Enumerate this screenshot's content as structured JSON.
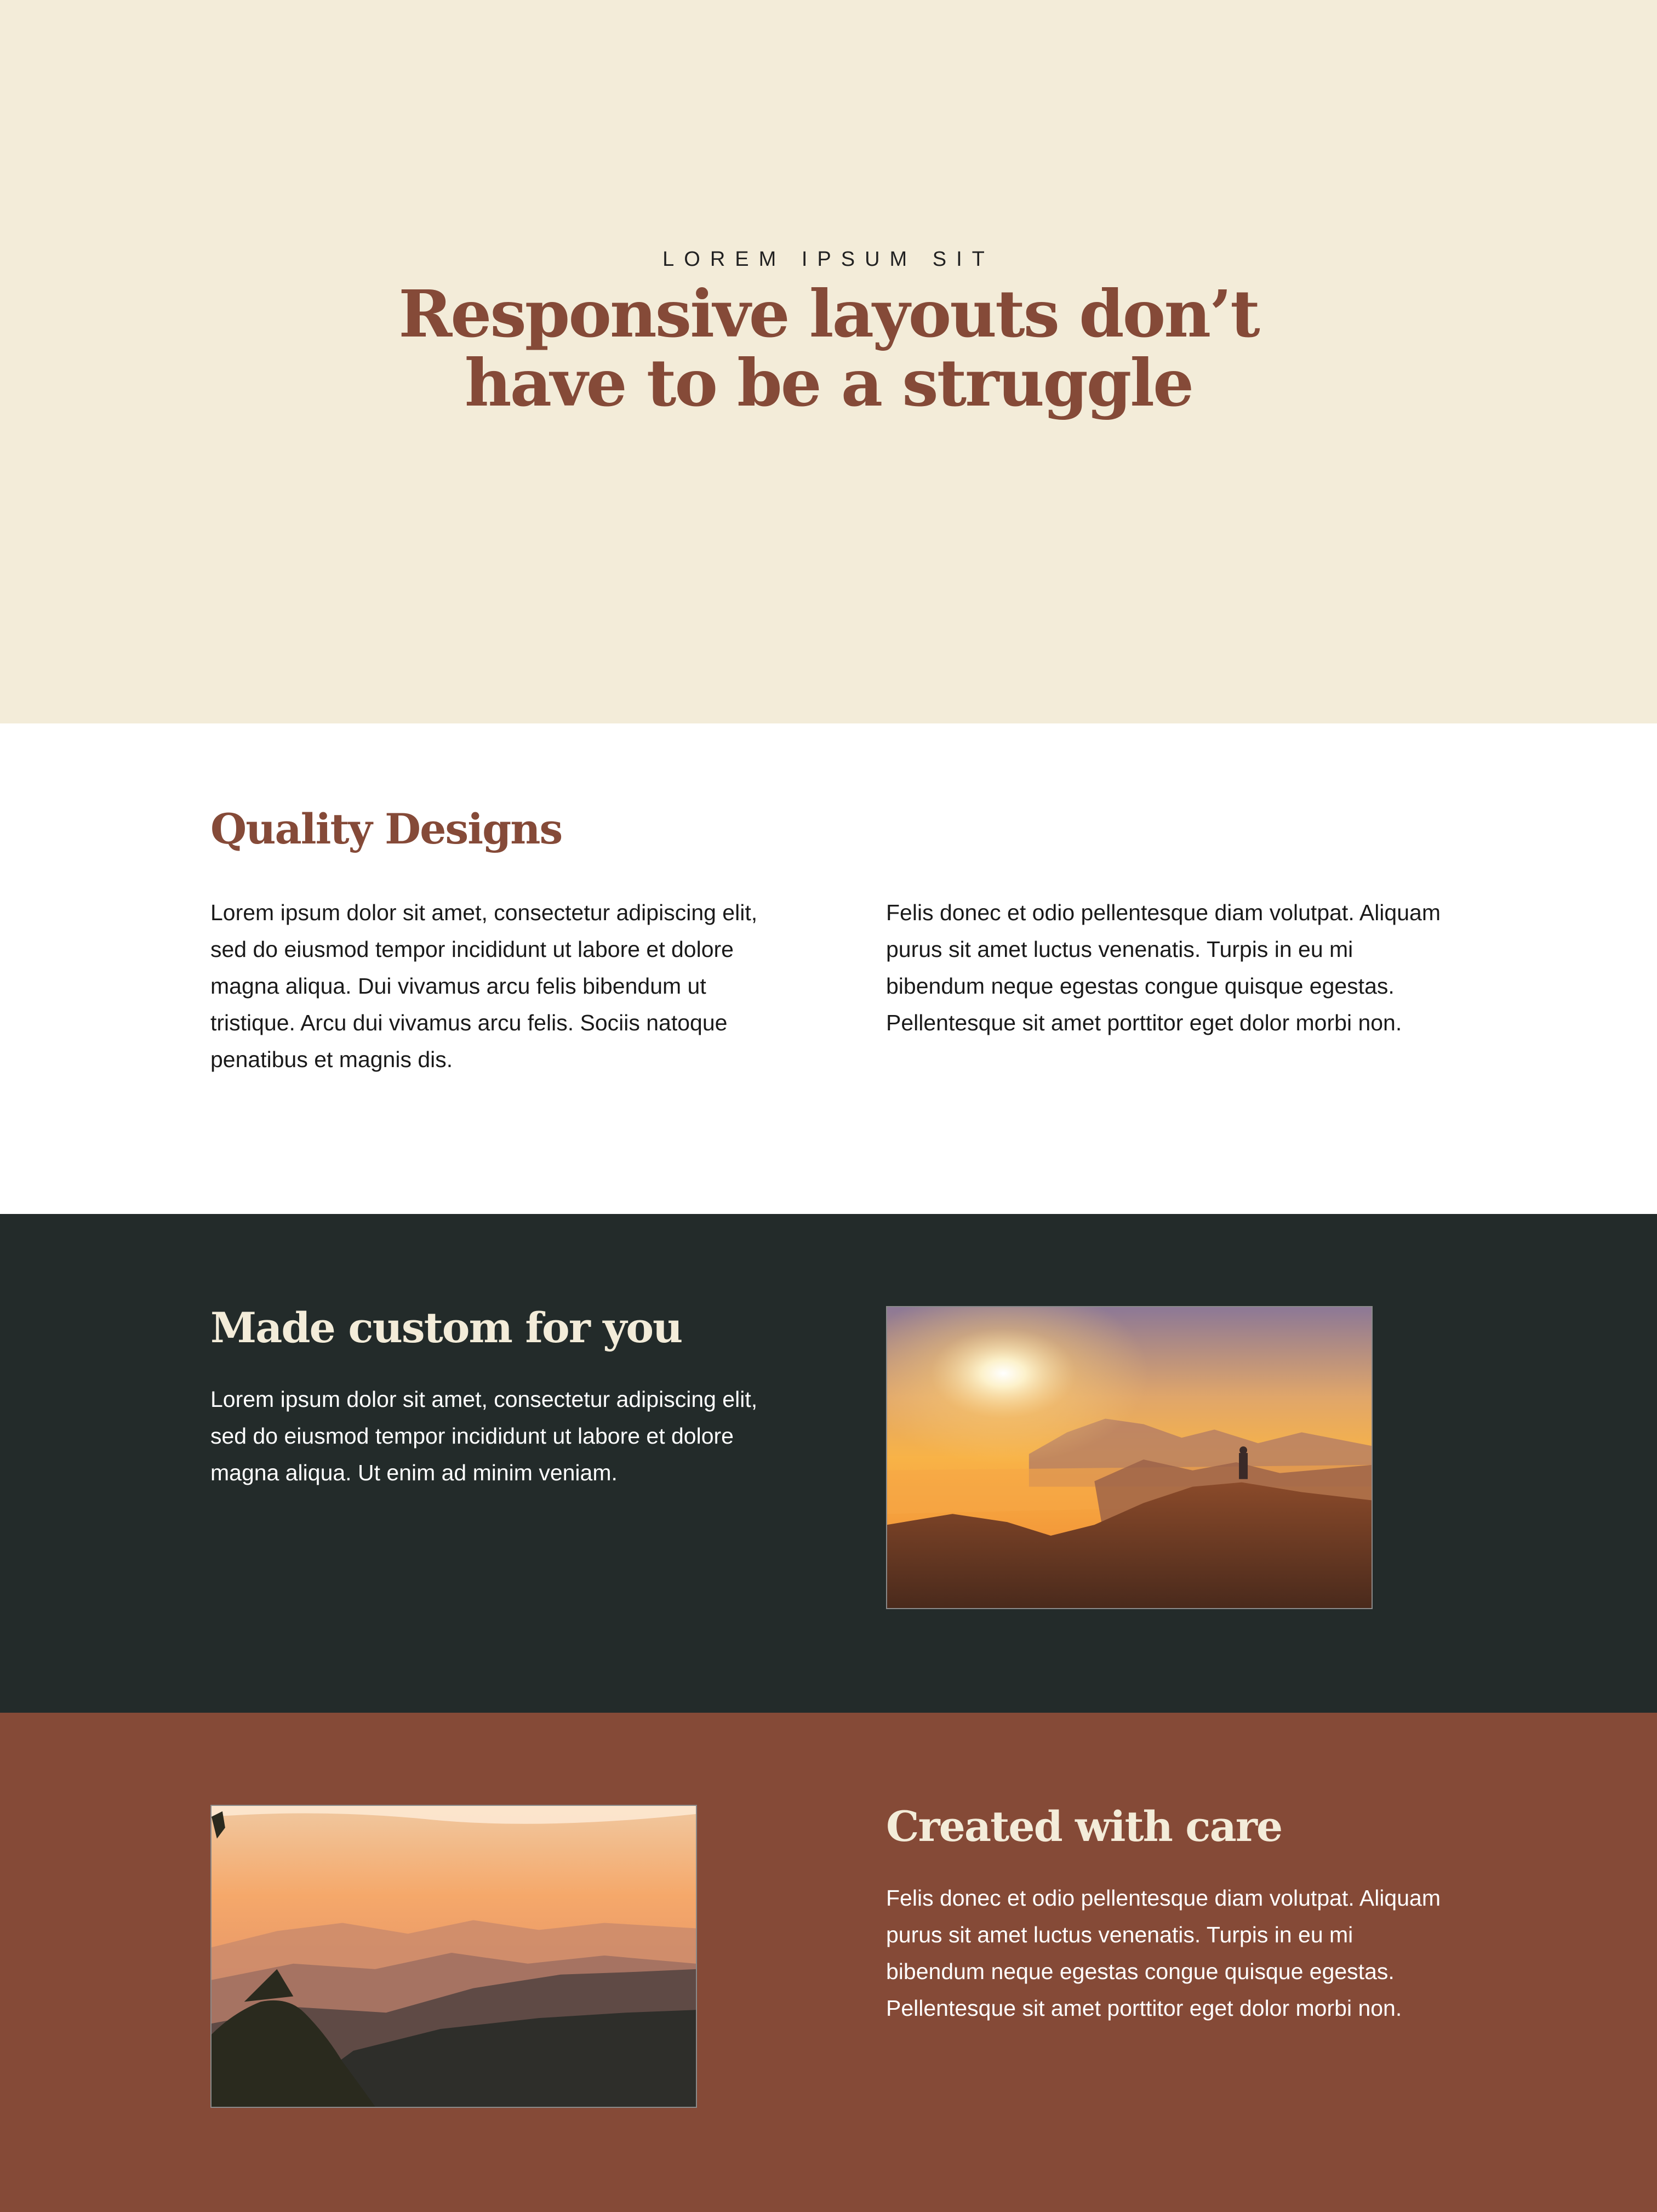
{
  "hero": {
    "eyebrow": "LOREM IPSUM SIT",
    "title_line1": "Responsive layouts don’t",
    "title_line2": "have to be a struggle"
  },
  "quality": {
    "heading": "Quality Designs",
    "left_text": "Lorem ipsum dolor sit amet, consectetur adipiscing elit, sed do eiusmod tempor incididunt ut labore et dolore magna aliqua. Dui vivamus arcu felis bibendum ut tristique. Arcu dui vivamus arcu felis. Sociis natoque penatibus et magnis dis.",
    "right_text": "Felis donec et odio pellentesque diam volutpat. Aliquam purus sit amet luctus venenatis. Turpis in eu mi bibendum neque egestas congue quisque egestas. Pellentesque sit amet porttitor eget dolor morbi non."
  },
  "custom": {
    "heading": "Made custom for you",
    "text": "Lorem ipsum dolor sit amet, consectetur adipiscing elit, sed do eiusmod tempor incididunt ut labore et dolore magna aliqua. Ut enim ad minim veniam."
  },
  "care": {
    "heading": "Created with care",
    "text": "Felis donec et odio pellentesque diam volutpat. Aliquam purus sit amet luctus venenatis. Turpis in eu mi bibendum neque egestas congue quisque egestas. Pellentesque sit amet porttitor eget dolor morbi non."
  },
  "colors": {
    "hero_bg": "#f3ecd9",
    "accent_brown": "#854a38",
    "dark_bg": "#232b2a",
    "cream_heading": "#f3ecd9"
  }
}
